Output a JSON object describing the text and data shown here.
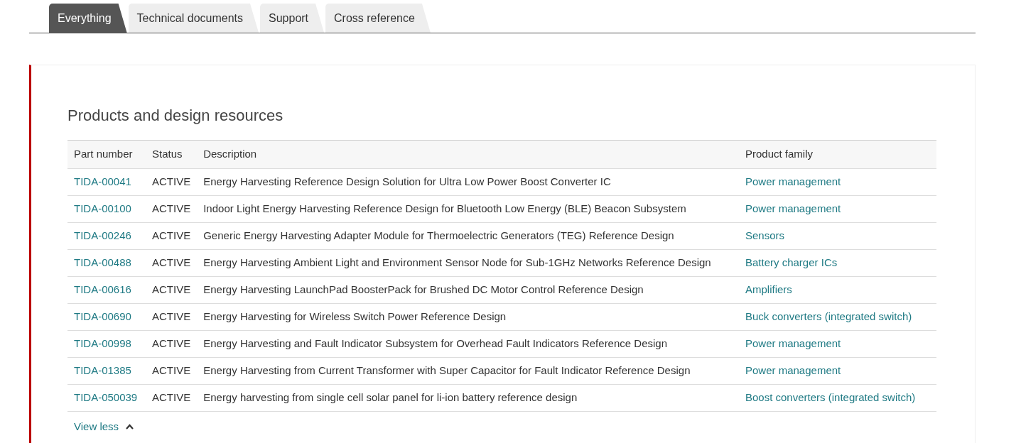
{
  "tabs": [
    {
      "label": "Everything",
      "selected": true
    },
    {
      "label": "Technical documents",
      "selected": false
    },
    {
      "label": "Support",
      "selected": false
    },
    {
      "label": "Cross reference",
      "selected": false
    }
  ],
  "section": {
    "title": "Products and design resources",
    "table": {
      "columns": [
        "Part number",
        "Status",
        "Description",
        "Product family"
      ],
      "rows": [
        {
          "part_number": "TIDA-00041",
          "status": "ACTIVE",
          "description": "Energy Harvesting Reference Design Solution for Ultra Low Power Boost Converter IC",
          "product_family": "Power management"
        },
        {
          "part_number": "TIDA-00100",
          "status": "ACTIVE",
          "description": "Indoor Light Energy Harvesting Reference Design for Bluetooth Low Energy (BLE) Beacon Subsystem",
          "product_family": "Power management"
        },
        {
          "part_number": "TIDA-00246",
          "status": "ACTIVE",
          "description": "Generic Energy Harvesting Adapter Module for Thermoelectric Generators (TEG) Reference Design",
          "product_family": "Sensors"
        },
        {
          "part_number": "TIDA-00488",
          "status": "ACTIVE",
          "description": "Energy Harvesting Ambient Light and Environment Sensor Node for Sub-1GHz Networks Reference Design",
          "product_family": "Battery charger ICs"
        },
        {
          "part_number": "TIDA-00616",
          "status": "ACTIVE",
          "description": "Energy Harvesting LaunchPad BoosterPack for Brushed DC Motor Control Reference Design",
          "product_family": "Amplifiers"
        },
        {
          "part_number": "TIDA-00690",
          "status": "ACTIVE",
          "description": "Energy Harvesting for Wireless Switch Power Reference Design",
          "product_family": "Buck converters (integrated switch)"
        },
        {
          "part_number": "TIDA-00998",
          "status": "ACTIVE",
          "description": "Energy Harvesting and Fault Indicator Subsystem for Overhead Fault Indicators Reference Design",
          "product_family": "Power management"
        },
        {
          "part_number": "TIDA-01385",
          "status": "ACTIVE",
          "description": "Energy Harvesting from Current Transformer with Super Capacitor for Fault Indicator Reference Design",
          "product_family": "Power management"
        },
        {
          "part_number": "TIDA-050039",
          "status": "ACTIVE",
          "description": "Energy harvesting from single cell solar panel for li-ion battery reference design",
          "product_family": "Boost converters (integrated switch)"
        }
      ]
    },
    "toggle_link": "View less"
  }
}
